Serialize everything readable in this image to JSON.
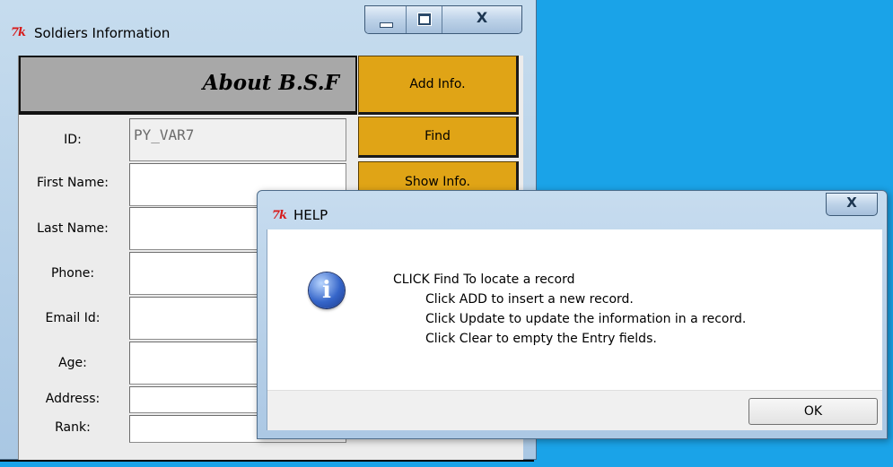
{
  "main_window": {
    "title": "Soldiers Information",
    "app_icon": "tk-feather-icon",
    "close_glyph": "X",
    "banner": "About B.S.F",
    "buttons": {
      "add": "Add Info.",
      "find": "Find",
      "show": "Show Info."
    },
    "fields": {
      "id_label": "ID:",
      "id_value": "PY_VAR7",
      "first_name_label": "First Name:",
      "last_name_label": "Last Name:",
      "phone_label": "Phone:",
      "email_label": "Email Id:",
      "age_label": "Age:",
      "address_label": "Address:",
      "rank_label": "Rank:"
    }
  },
  "help_dialog": {
    "title": "HELP",
    "close_glyph": "X",
    "icon": "info-icon",
    "messages": [
      "CLICK Find To locate a record",
      "Click ADD to insert a new record.",
      "Click Update to update the information in a record.",
      "Click Clear to empty the Entry fields."
    ],
    "ok_label": "OK"
  },
  "colors": {
    "desktop": "#1aa3e8",
    "button_gold": "#e0a416",
    "banner_gray": "#a8a8a8",
    "info_blue": "#3565c9"
  }
}
